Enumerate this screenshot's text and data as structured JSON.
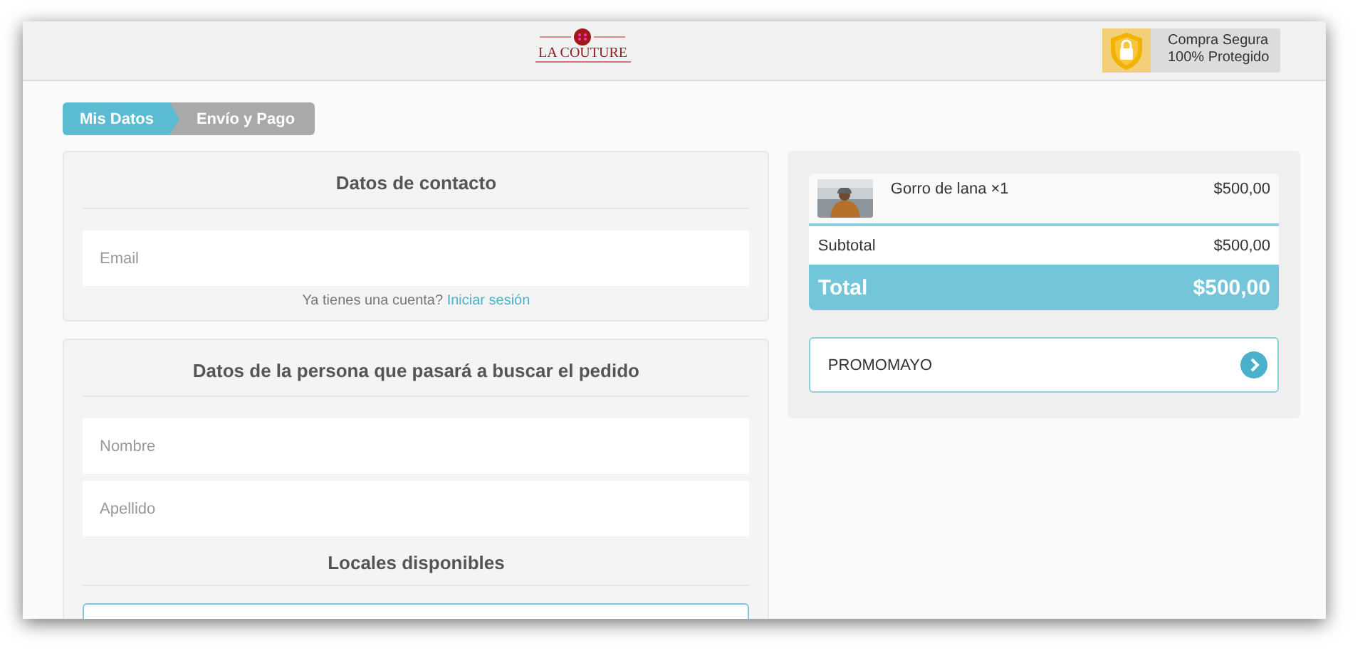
{
  "header": {
    "logo": "LA COUTURE",
    "badge": {
      "title": "Compra Segura",
      "subtitle": "100% Protegido"
    }
  },
  "steps": [
    {
      "label": "Mis Datos",
      "selected": true
    },
    {
      "label": "Envío y Pago",
      "selected": false
    }
  ],
  "contact": {
    "title": "Datos de contacto",
    "fields": [
      {
        "placeholder": "Email"
      }
    ],
    "login_prompt": "Ya tienes una cuenta?",
    "login_link": "Iniciar sesión"
  },
  "pickup": {
    "title": "Datos de la persona que pasará a buscar el pedido",
    "fields": [
      {
        "placeholder": "Nombre"
      },
      {
        "placeholder": "Apellido"
      }
    ],
    "stores_title": "Locales disponibles"
  },
  "cart": {
    "items": [
      {
        "kind": "picture",
        "name": "Gorro de lana ×1",
        "price": "$500,00"
      }
    ],
    "subtotal": {
      "label": "Subtotal",
      "value": "$500,00"
    },
    "total": {
      "label": "Total",
      "value": "$500,00"
    },
    "coupon": {
      "value": "PROMOMAYO"
    }
  }
}
